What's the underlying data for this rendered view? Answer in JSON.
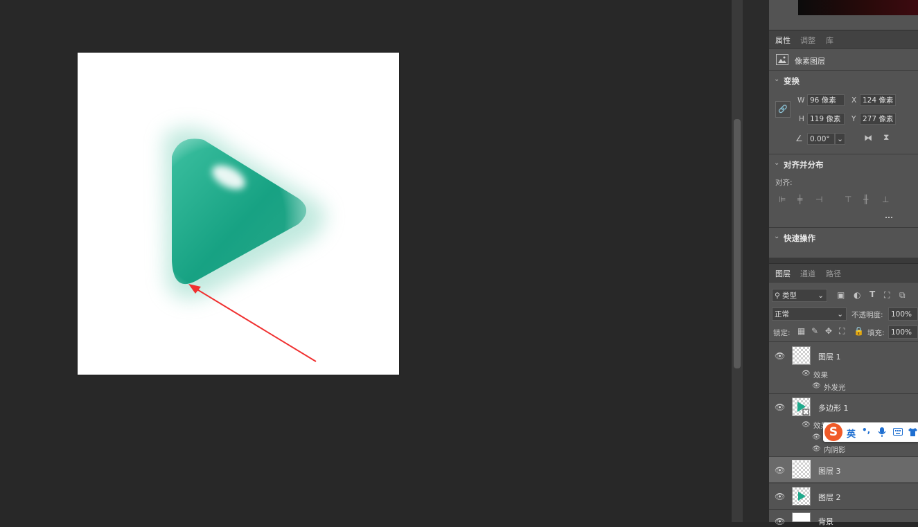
{
  "properties": {
    "tabs": [
      "属性",
      "调整",
      "库"
    ],
    "layer_type": "像素图层",
    "transform": {
      "title": "变换",
      "w_label": "W",
      "w_value": "96 像素",
      "x_label": "X",
      "x_value": "124 像素",
      "h_label": "H",
      "h_value": "119 像素",
      "y_label": "Y",
      "y_value": "277 像素",
      "angle_value": "0.00°"
    },
    "align": {
      "title": "对齐并分布",
      "label": "对齐:",
      "more": "..."
    },
    "quick": {
      "title": "快速操作"
    }
  },
  "layers_panel": {
    "tabs": [
      "图层",
      "通道",
      "路径"
    ],
    "filter_label": "类型",
    "blend_mode": "正常",
    "opacity_label": "不透明度:",
    "opacity_value": "100%",
    "lock_label": "锁定:",
    "fill_label": "填充:",
    "fill_value": "100%",
    "layers": [
      {
        "name": "图层 1",
        "effects_label": "效果",
        "effects": [
          "外发光"
        ]
      },
      {
        "name": "多边形 1",
        "effects_label": "效果",
        "effects": [
          "内阴影"
        ]
      },
      {
        "name": "图层 3"
      },
      {
        "name": "图层 2"
      },
      {
        "name": "背景"
      }
    ]
  },
  "ime_toolbar": {
    "logo": "S",
    "lang": "英",
    "punct": "•,",
    "icons": [
      "microphone-icon",
      "keyboard-icon",
      "shirt-icon"
    ]
  },
  "colors": {
    "accent_teal": "#1faa8c",
    "arrow_red": "#f03030",
    "panel_bg": "#535353",
    "workspace_bg": "#282828"
  }
}
